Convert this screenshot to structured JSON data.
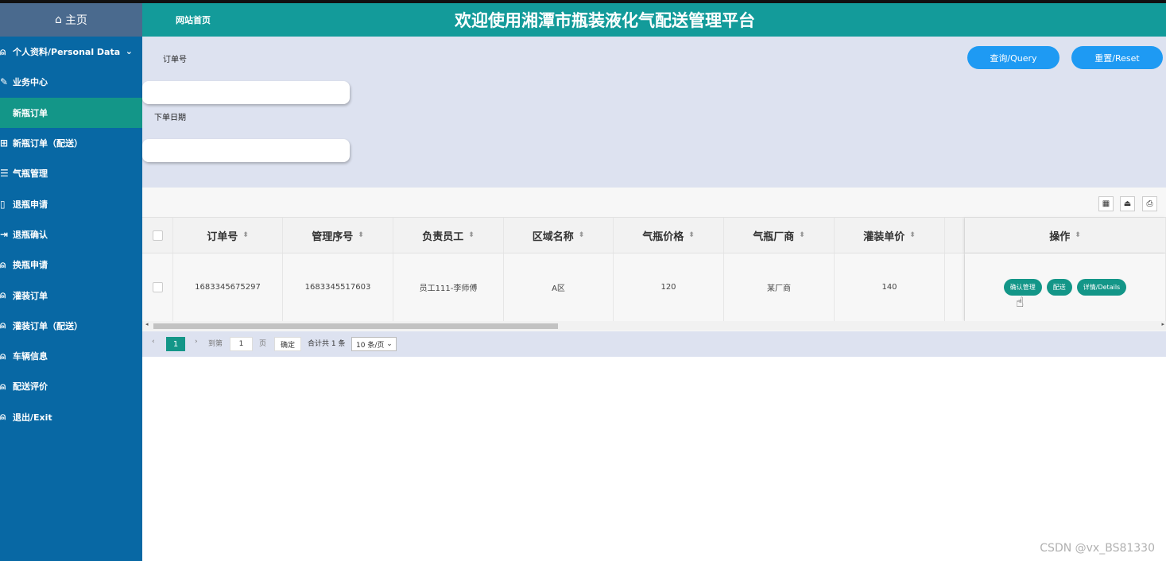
{
  "sidebar": {
    "home_label": "主页",
    "items": [
      {
        "label": "个人资料/Personal Data",
        "icon": "user-icon"
      },
      {
        "label": "业务中心",
        "icon": "edit-icon"
      },
      {
        "label": "新瓶订单",
        "icon": ""
      },
      {
        "label": "新瓶订单（配送）",
        "icon": "grid-icon"
      },
      {
        "label": "气瓶管理",
        "icon": "card-icon"
      },
      {
        "label": "退瓶申请",
        "icon": "doc-icon"
      },
      {
        "label": "退瓶确认",
        "icon": "export-icon"
      },
      {
        "label": "换瓶申请",
        "icon": "user-icon"
      },
      {
        "label": "灌装订单",
        "icon": "user-icon"
      },
      {
        "label": "灌装订单（配送）",
        "icon": "user-icon"
      },
      {
        "label": "车辆信息",
        "icon": "user-icon"
      },
      {
        "label": "配送评价",
        "icon": "user-icon"
      },
      {
        "label": "退出/Exit",
        "icon": "user-icon"
      }
    ]
  },
  "header": {
    "home_link": "网站首页",
    "title": "欢迎使用湘潭市瓶装液化气配送管理平台"
  },
  "search": {
    "order_no_label": "订单号",
    "order_date_label": "下单日期",
    "query_button": "查询/Query",
    "reset_button": "重置/Reset"
  },
  "table": {
    "columns": [
      "订单号",
      "管理序号",
      "负责员工",
      "区域名称",
      "气瓶价格",
      "气瓶厂商",
      "灌装单价",
      "操作"
    ],
    "rows": [
      [
        "1683345675297",
        "1683345517603",
        "员工111-李师傅",
        "A区",
        "120",
        "某厂商",
        "140"
      ]
    ],
    "row_actions": [
      "确认管理",
      "配送",
      "详情/Details"
    ]
  },
  "pager": {
    "current_page": "1",
    "goto_label": "到第",
    "goto_value": "1",
    "page_unit": "页",
    "confirm": "确定",
    "total": "合计共 1 条",
    "page_size": "10 条/页"
  },
  "watermark": "CSDN @vx_BS81330",
  "colors": {
    "sidebar_bg": "#0868a4",
    "header_bg": "#139b9a",
    "accent_green": "#139688",
    "button_blue": "#1e9af3",
    "panel_bg": "#dde2f0"
  }
}
